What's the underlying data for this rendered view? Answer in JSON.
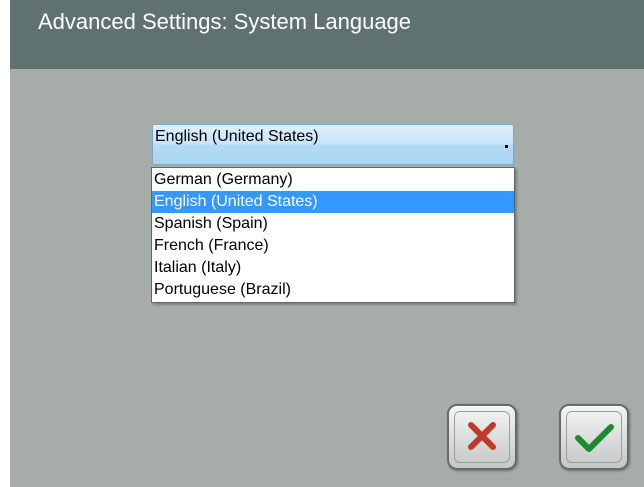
{
  "header": {
    "title": "Advanced Settings: System Language"
  },
  "language_select": {
    "selected_value": "English (United States)",
    "options": [
      "German (Germany)",
      "English (United States)",
      "Spanish (Spain)",
      "French (France)",
      "Italian (Italy)",
      "Portuguese (Brazil)"
    ],
    "highlighted_option": "English (United States)"
  },
  "actions": {
    "cancel_icon": "x-icon",
    "confirm_icon": "checkmark-icon"
  },
  "colors": {
    "header_bg": "#5f7171",
    "screen_bg": "#a6acaa",
    "highlight": "#3399ff",
    "cancel_red": "#c0392b",
    "confirm_green": "#1e8a2f"
  }
}
